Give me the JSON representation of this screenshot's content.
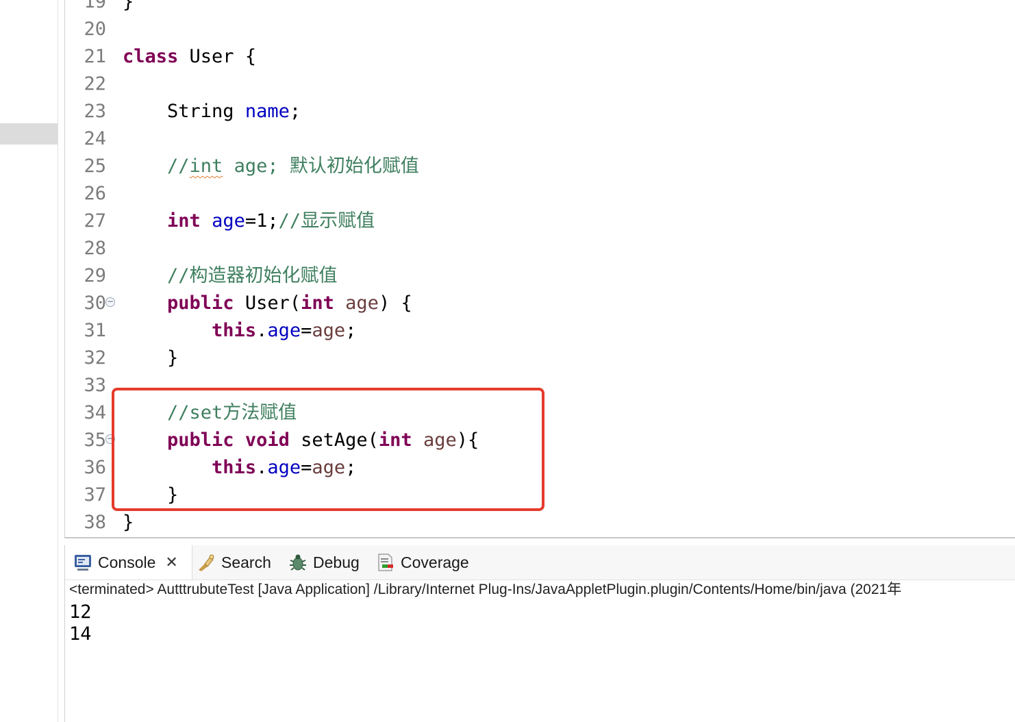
{
  "editor": {
    "lines": [
      {
        "num": "19",
        "tokens": [
          {
            "t": "}",
            "c": ""
          }
        ]
      },
      {
        "num": "20",
        "tokens": []
      },
      {
        "num": "21",
        "tokens": [
          {
            "t": "class",
            "c": "kw"
          },
          {
            "t": " User {",
            "c": ""
          }
        ]
      },
      {
        "num": "22",
        "tokens": []
      },
      {
        "num": "23",
        "tokens": [
          {
            "t": "    String ",
            "c": ""
          },
          {
            "t": "name",
            "c": "fld"
          },
          {
            "t": ";",
            "c": ""
          }
        ]
      },
      {
        "num": "24",
        "tokens": []
      },
      {
        "num": "25",
        "tokens": [
          {
            "t": "    //",
            "c": "cmt"
          },
          {
            "t": "int",
            "c": "cmt squig"
          },
          {
            "t": " age; 默认初始化赋值",
            "c": "cmt"
          }
        ]
      },
      {
        "num": "26",
        "tokens": []
      },
      {
        "num": "27",
        "tokens": [
          {
            "t": "    ",
            "c": ""
          },
          {
            "t": "int",
            "c": "kw"
          },
          {
            "t": " ",
            "c": ""
          },
          {
            "t": "age",
            "c": "fld"
          },
          {
            "t": "=1;",
            "c": ""
          },
          {
            "t": "//显示赋值",
            "c": "cmt"
          }
        ]
      },
      {
        "num": "28",
        "tokens": []
      },
      {
        "num": "29",
        "tokens": [
          {
            "t": "    //构造器初始化赋值",
            "c": "cmt"
          }
        ]
      },
      {
        "num": "30",
        "fold": true,
        "tokens": [
          {
            "t": "    ",
            "c": ""
          },
          {
            "t": "public",
            "c": "kw"
          },
          {
            "t": " User(",
            "c": ""
          },
          {
            "t": "int",
            "c": "kw"
          },
          {
            "t": " ",
            "c": ""
          },
          {
            "t": "age",
            "c": "par"
          },
          {
            "t": ") {",
            "c": ""
          }
        ]
      },
      {
        "num": "31",
        "tokens": [
          {
            "t": "        ",
            "c": ""
          },
          {
            "t": "this",
            "c": "kw"
          },
          {
            "t": ".",
            "c": ""
          },
          {
            "t": "age",
            "c": "fld"
          },
          {
            "t": "=",
            "c": ""
          },
          {
            "t": "age",
            "c": "par"
          },
          {
            "t": ";",
            "c": ""
          }
        ]
      },
      {
        "num": "32",
        "tokens": [
          {
            "t": "    }",
            "c": ""
          }
        ]
      },
      {
        "num": "33",
        "tokens": []
      },
      {
        "num": "34",
        "tokens": [
          {
            "t": "    //set方法赋值",
            "c": "cmt"
          }
        ]
      },
      {
        "num": "35",
        "fold": true,
        "tokens": [
          {
            "t": "    ",
            "c": ""
          },
          {
            "t": "public",
            "c": "kw"
          },
          {
            "t": " ",
            "c": ""
          },
          {
            "t": "void",
            "c": "kw"
          },
          {
            "t": " setAge(",
            "c": ""
          },
          {
            "t": "int",
            "c": "kw"
          },
          {
            "t": " ",
            "c": ""
          },
          {
            "t": "age",
            "c": "par"
          },
          {
            "t": "){",
            "c": ""
          }
        ]
      },
      {
        "num": "36",
        "tokens": [
          {
            "t": "        ",
            "c": ""
          },
          {
            "t": "this",
            "c": "kw"
          },
          {
            "t": ".",
            "c": ""
          },
          {
            "t": "age",
            "c": "fld"
          },
          {
            "t": "=",
            "c": ""
          },
          {
            "t": "age",
            "c": "par"
          },
          {
            "t": ";",
            "c": ""
          }
        ]
      },
      {
        "num": "37",
        "tokens": [
          {
            "t": "    }",
            "c": ""
          }
        ]
      },
      {
        "num": "38",
        "tokens": [
          {
            "t": "}",
            "c": ""
          }
        ]
      }
    ]
  },
  "console": {
    "tabs": [
      {
        "label": "Console",
        "icon": "console-icon",
        "active": true,
        "closable": true
      },
      {
        "label": "Search",
        "icon": "search-icon"
      },
      {
        "label": "Debug",
        "icon": "debug-bug-icon"
      },
      {
        "label": "Coverage",
        "icon": "coverage-icon"
      }
    ],
    "status": "<terminated> AutttrubuteTest [Java Application] /Library/Internet Plug-Ins/JavaAppletPlugin.plugin/Contents/Home/bin/java  (2021年",
    "output": [
      "12",
      "14"
    ]
  },
  "colors": {
    "keyword": "#7f0055",
    "field": "#0000c0",
    "comment": "#3f7f5f",
    "parameter": "#6a3e3e",
    "highlight_border": "#e53b2c"
  }
}
